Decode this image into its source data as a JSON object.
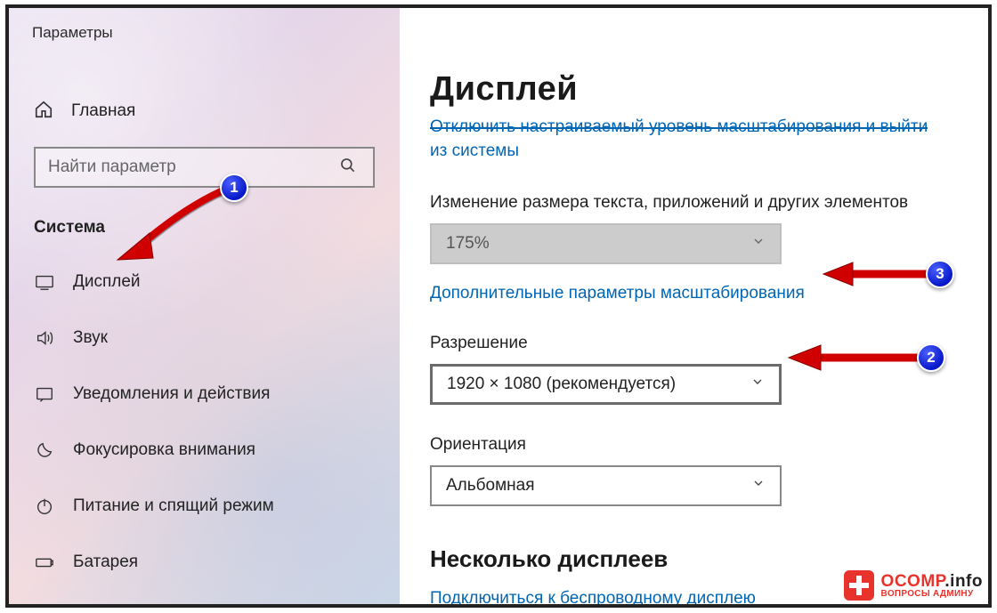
{
  "app_title": "Параметры",
  "home_label": "Главная",
  "search": {
    "placeholder": "Найти параметр"
  },
  "sidebar": {
    "section": "Система",
    "items": [
      {
        "label": "Дисплей"
      },
      {
        "label": "Звук"
      },
      {
        "label": "Уведомления и действия"
      },
      {
        "label": "Фокусировка внимания"
      },
      {
        "label": "Питание и спящий режим"
      },
      {
        "label": "Батарея"
      }
    ]
  },
  "main": {
    "title": "Дисплей",
    "scale_off_line1": "Отключить настраиваемый уровень масштабирования и выйти",
    "scale_off_line2": "из системы",
    "scale": {
      "label": "Изменение размера текста, приложений и других элементов",
      "value": "175%"
    },
    "advanced_scaling_link": "Дополнительные параметры масштабирования",
    "resolution": {
      "label": "Разрешение",
      "value": "1920 × 1080 (рекомендуется)"
    },
    "orientation": {
      "label": "Ориентация",
      "value": "Альбомная"
    },
    "multi_title": "Несколько дисплеев",
    "wireless_link": "Подключиться к беспроводному дисплею"
  },
  "annotations": {
    "b1": "1",
    "b2": "2",
    "b3": "3"
  },
  "watermark": {
    "brand": "OCOMP",
    "suffix": ".info",
    "tagline": "ВОПРОСЫ АДМИНУ"
  }
}
